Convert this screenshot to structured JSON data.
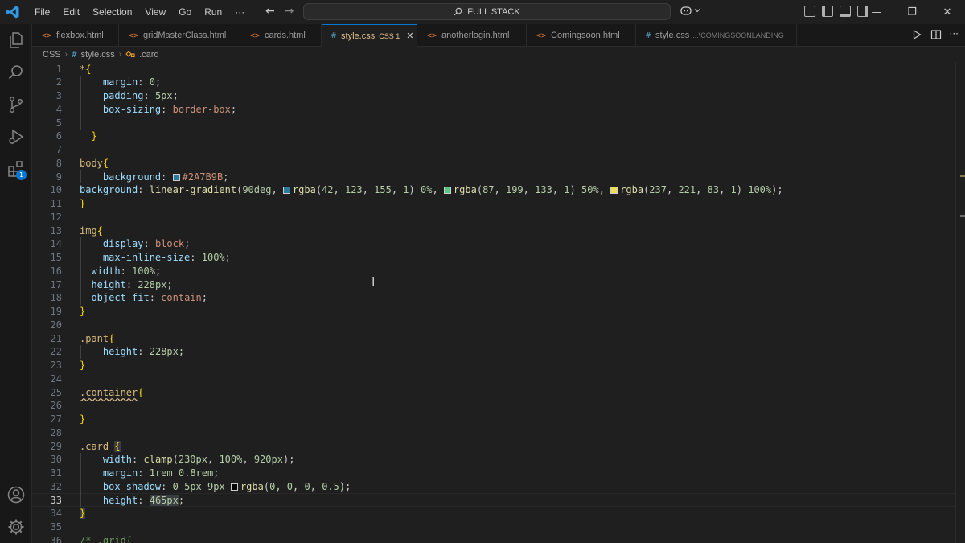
{
  "menu": [
    "File",
    "Edit",
    "Selection",
    "View",
    "Go",
    "Run",
    "···"
  ],
  "command_center": {
    "label": "FULL STACK",
    "icon": "search-icon"
  },
  "tabs": [
    {
      "label": "flexbox.html",
      "icon": "<>",
      "type": "html"
    },
    {
      "label": "gridMasterClass.html",
      "icon": "<>",
      "type": "html"
    },
    {
      "label": "cards.html",
      "icon": "<>",
      "type": "html"
    },
    {
      "label": "style.css",
      "icon": "#",
      "type": "css",
      "active": true,
      "problems": "CSS 1",
      "close": "✕"
    },
    {
      "label": "anotherlogin.html",
      "icon": "<>",
      "type": "html"
    },
    {
      "label": "Comingsoon.html",
      "icon": "<>",
      "type": "html"
    },
    {
      "label": "style.css",
      "icon": "#",
      "type": "css",
      "desc": "...\\COMINGSOONLANDING"
    }
  ],
  "breadcrumb": {
    "folder": "CSS",
    "file": "style.css",
    "symbol": ".card"
  },
  "editor": {
    "current_line": 33,
    "line_numbers": [
      "1",
      "2",
      "3",
      "4",
      "5",
      "6",
      "7",
      "8",
      "9",
      "10",
      "11",
      "12",
      "13",
      "14",
      "15",
      "16",
      "17",
      "18",
      "19",
      "20",
      "21",
      "22",
      "23",
      "24",
      "25",
      "26",
      "27",
      "28",
      "29",
      "30",
      "31",
      "32",
      "33",
      "34",
      "35",
      "36"
    ],
    "lines": [
      "*{",
      "    margin: 0;",
      "    padding: 5px;",
      "    box-sizing: border-box;",
      "",
      "  }",
      "",
      "body{",
      "    background: #2A7B9B;",
      "background: linear-gradient(90deg, rgba(42, 123, 155, 1) 0%, rgba(87, 199, 133, 1) 50%, rgba(237, 221, 83, 1) 100%);",
      "}",
      "",
      "img{",
      "    display: block;",
      "    max-inline-size: 100%;",
      "  width: 100%;",
      "  height: 228px;",
      "  object-fit: contain;",
      "}",
      "",
      ".pant{",
      "    height: 228px;",
      "}",
      "",
      ".container{",
      "",
      "}",
      "",
      ".card {",
      "    width: clamp(230px, 100%, 920px);",
      "    margin: 1rem 0.8rem;",
      "    box-shadow: 0 5px 9px rgba(0, 0, 0, 0.5);",
      "    height: 465px;",
      "}",
      "",
      "/* .grid{"
    ]
  },
  "colors": {
    "swatch_bg": "#2A7B9B",
    "swatch_g1": "#2A7B9B",
    "swatch_g2": "#57C785",
    "swatch_g3": "#EDDD53",
    "swatch_shadow": "#000000",
    "accent": "#0078d4"
  },
  "activity_badge": "1"
}
